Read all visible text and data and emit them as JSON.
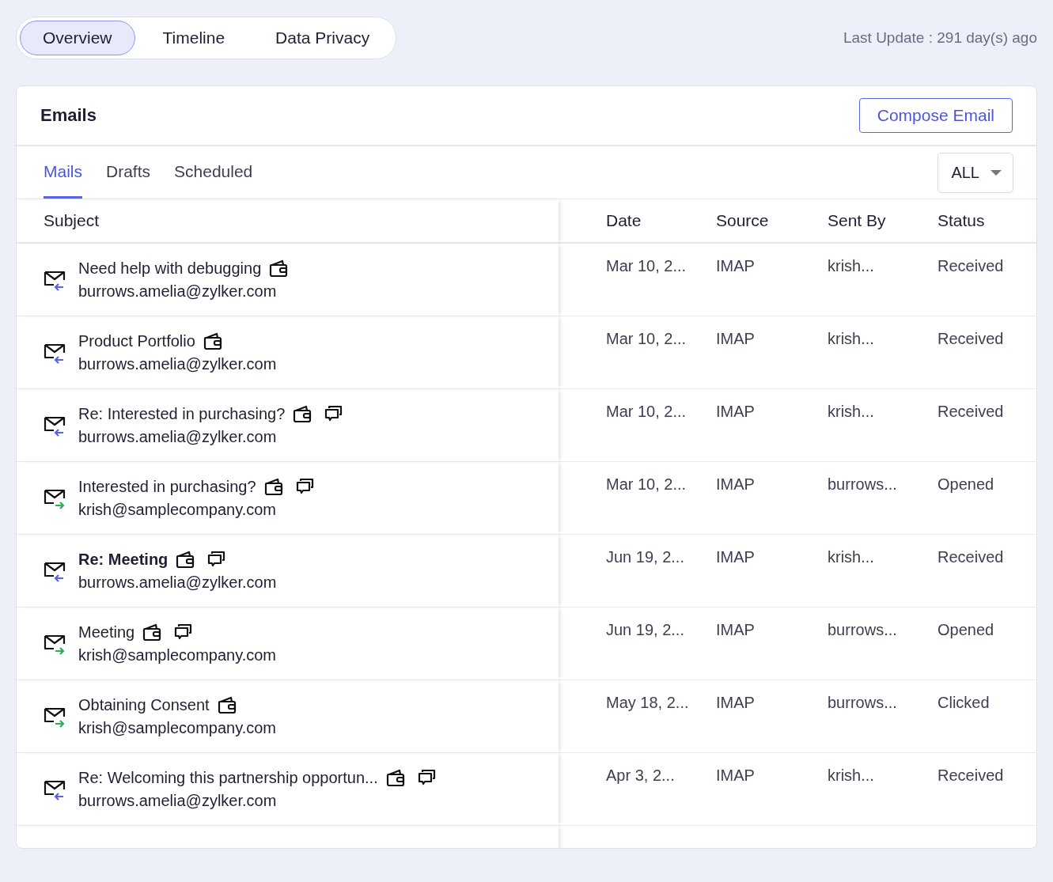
{
  "tabs": [
    {
      "label": "Overview",
      "selected": true
    },
    {
      "label": "Timeline",
      "selected": false
    },
    {
      "label": "Data Privacy",
      "selected": false
    }
  ],
  "last_update": "Last Update : 291 day(s) ago",
  "emails": {
    "title": "Emails",
    "compose_button": "Compose Email",
    "subtabs": [
      {
        "label": "Mails",
        "selected": true
      },
      {
        "label": "Drafts",
        "selected": false
      },
      {
        "label": "Scheduled",
        "selected": false
      }
    ],
    "filter": "ALL",
    "columns": [
      "Subject",
      "Date",
      "Source",
      "Sent By",
      "Status"
    ],
    "rows": [
      {
        "subject": "Need help with debugging",
        "address": "burrows.amelia@zylker.com",
        "kind": "incoming",
        "bold": false,
        "has_comments": false,
        "date": "Mar 10, 2...",
        "source": "IMAP",
        "sent_by": "krish...",
        "status": "Received"
      },
      {
        "subject": "Product Portfolio",
        "address": "burrows.amelia@zylker.com",
        "kind": "incoming",
        "bold": false,
        "has_comments": false,
        "date": "Mar 10, 2...",
        "source": "IMAP",
        "sent_by": "krish...",
        "status": "Received"
      },
      {
        "subject": "Re: Interested in purchasing?",
        "address": "burrows.amelia@zylker.com",
        "kind": "incoming",
        "bold": false,
        "has_comments": true,
        "date": "Mar 10, 2...",
        "source": "IMAP",
        "sent_by": "krish...",
        "status": "Received"
      },
      {
        "subject": "Interested in purchasing?",
        "address": "krish@samplecompany.com",
        "kind": "outgoing",
        "bold": false,
        "has_comments": true,
        "date": "Mar 10, 2...",
        "source": "IMAP",
        "sent_by": "burrows...",
        "status": "Opened"
      },
      {
        "subject": "Re: Meeting",
        "address": "burrows.amelia@zylker.com",
        "kind": "incoming",
        "bold": true,
        "has_comments": true,
        "date": "Jun 19, 2...",
        "source": "IMAP",
        "sent_by": "krish...",
        "status": "Received"
      },
      {
        "subject": "Meeting",
        "address": "krish@samplecompany.com",
        "kind": "outgoing",
        "bold": false,
        "has_comments": true,
        "date": "Jun 19, 2...",
        "source": "IMAP",
        "sent_by": "burrows...",
        "status": "Opened"
      },
      {
        "subject": "Obtaining Consent",
        "address": "krish@samplecompany.com",
        "kind": "outgoing",
        "bold": false,
        "has_comments": false,
        "date": "May 18, 2...",
        "source": "IMAP",
        "sent_by": "burrows...",
        "status": "Clicked"
      },
      {
        "subject": "Re: Welcoming this partnership opportun...",
        "address": "burrows.amelia@zylker.com",
        "kind": "incoming",
        "bold": false,
        "has_comments": true,
        "date": "Apr 3, 2...",
        "source": "IMAP",
        "sent_by": "krish...",
        "status": "Received"
      }
    ]
  }
}
